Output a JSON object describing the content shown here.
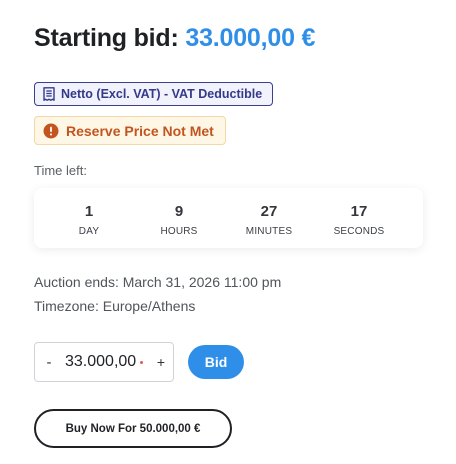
{
  "header": {
    "label": "Starting bid:",
    "price": "33.000,00 €"
  },
  "badges": {
    "vat": {
      "text": "Netto (Excl. VAT) - VAT Deductible",
      "icon": "receipt-icon"
    },
    "reserve": {
      "text": "Reserve Price Not Met",
      "icon": "alert-circle-icon"
    }
  },
  "countdown": {
    "label": "Time left:",
    "units": [
      {
        "value": "1",
        "unit": "DAY"
      },
      {
        "value": "9",
        "unit": "HOURS"
      },
      {
        "value": "27",
        "unit": "MINUTES"
      },
      {
        "value": "17",
        "unit": "SECONDS"
      }
    ]
  },
  "auction": {
    "ends": "Auction ends: March 31, 2026 11:00 pm",
    "timezone": "Timezone: Europe/Athens"
  },
  "bid_form": {
    "minus": "-",
    "value": "33.000,00",
    "plus": "+",
    "bid_label": "Bid"
  },
  "buy_now": {
    "label": "Buy Now For 50.000,00 €"
  },
  "colors": {
    "accent": "#2f8fe8",
    "vat_badge": "#34398a",
    "reserve_badge": "#c2551f"
  }
}
